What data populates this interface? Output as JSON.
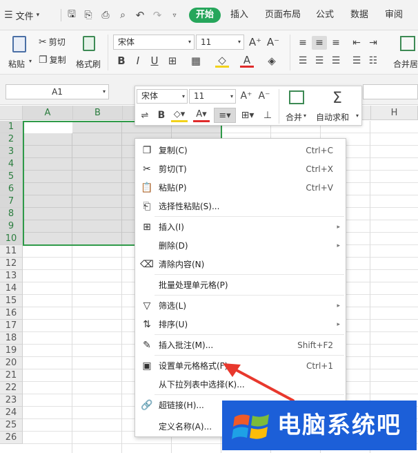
{
  "menubar": {
    "file_label": "文件",
    "tabs": [
      "开始",
      "插入",
      "页面布局",
      "公式",
      "数据",
      "审阅"
    ]
  },
  "ribbon": {
    "paste": "粘贴",
    "cut": "剪切",
    "copy": "复制",
    "format_painter": "格式刷",
    "font_name": "宋体",
    "font_size": "11",
    "merge_center": "合并居"
  },
  "formula_bar": {
    "cell_ref": "A1"
  },
  "grid": {
    "columns": [
      "A",
      "B",
      "C",
      "D",
      "E",
      "F",
      "G",
      "H"
    ],
    "rows": [
      "1",
      "2",
      "3",
      "4",
      "5",
      "6",
      "7",
      "8",
      "9",
      "10",
      "11",
      "12",
      "13",
      "14",
      "15",
      "16",
      "17",
      "18",
      "19",
      "20",
      "21",
      "22",
      "23",
      "24",
      "25",
      "26"
    ]
  },
  "mini_toolbar": {
    "font_name": "宋体",
    "font_size": "11",
    "merge": "合并",
    "autosum": "自动求和"
  },
  "context_menu": {
    "items": [
      {
        "label": "复制(C)",
        "shortcut": "Ctrl+C",
        "icon": "copy-icon"
      },
      {
        "label": "剪切(T)",
        "shortcut": "Ctrl+X",
        "icon": "scissors-icon"
      },
      {
        "label": "粘贴(P)",
        "shortcut": "Ctrl+V",
        "icon": "paste-icon"
      },
      {
        "label": "选择性粘贴(S)...",
        "icon": "paste-special-icon"
      },
      {
        "label": "插入(I)",
        "icon": "insert-icon",
        "submenu": true
      },
      {
        "label": "删除(D)",
        "submenu": true
      },
      {
        "label": "清除内容(N)",
        "icon": "eraser-icon"
      },
      {
        "label": "批量处理单元格(P)"
      },
      {
        "label": "筛选(L)",
        "icon": "filter-icon",
        "submenu": true
      },
      {
        "label": "排序(U)",
        "icon": "sort-icon",
        "submenu": true
      },
      {
        "label": "插入批注(M)...",
        "shortcut": "Shift+F2",
        "icon": "comment-icon"
      },
      {
        "label": "设置单元格格式(F)...",
        "shortcut": "Ctrl+1",
        "icon": "format-cells-icon"
      },
      {
        "label": "从下拉列表中选择(K)..."
      },
      {
        "label": "超链接(H)...",
        "icon": "link-icon"
      },
      {
        "label": "定义名称(A)..."
      }
    ]
  },
  "watermark": {
    "text": "电脑系统吧"
  },
  "colors": {
    "accent": "#26a65b",
    "selection_border": "#2e9a48",
    "arrow": "#e8382d",
    "watermark_bg": "#1c5fd8"
  }
}
